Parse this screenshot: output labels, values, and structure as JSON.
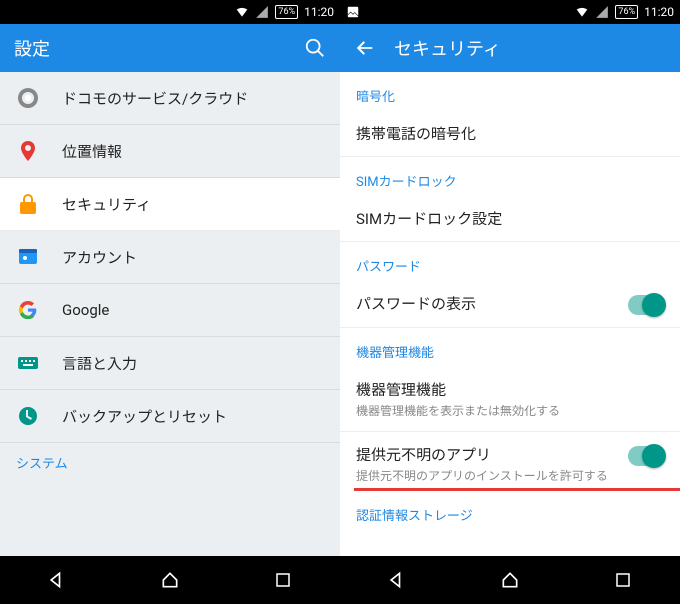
{
  "statusbar": {
    "battery": "76%",
    "time": "11:20"
  },
  "left": {
    "title": "設定",
    "items": [
      {
        "icon": "gear-icon",
        "label": "ドコモのサービス/クラウド"
      },
      {
        "icon": "pin-icon",
        "label": "位置情報"
      },
      {
        "icon": "lock-icon",
        "label": "セキュリティ",
        "selected": true
      },
      {
        "icon": "id-icon",
        "label": "アカウント"
      },
      {
        "icon": "google-icon",
        "label": "Google"
      },
      {
        "icon": "keyboard-icon",
        "label": "言語と入力"
      },
      {
        "icon": "restore-icon",
        "label": "バックアップとリセット"
      }
    ],
    "bottom_category": "システム"
  },
  "right": {
    "title": "セキュリティ",
    "sections": {
      "encryption": {
        "header": "暗号化",
        "item": "携帯電話の暗号化"
      },
      "sim": {
        "header": "SIMカードロック",
        "item": "SIMカードロック設定"
      },
      "password": {
        "header": "パスワード",
        "item": "パスワードの表示"
      },
      "admin": {
        "header": "機器管理機能",
        "item1_title": "機器管理機能",
        "item1_sub": "機器管理機能を表示または無効化する",
        "item2_title": "提供元不明のアプリ",
        "item2_sub": "提供元不明のアプリのインストールを許可する"
      },
      "cred": {
        "header": "認証情報ストレージ"
      }
    }
  }
}
